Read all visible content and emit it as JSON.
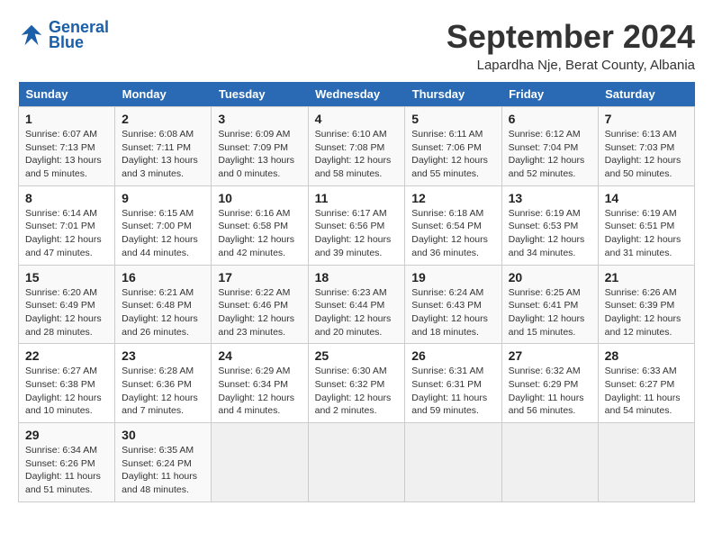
{
  "header": {
    "logo_line1": "General",
    "logo_line2": "Blue",
    "month_title": "September 2024",
    "location": "Lapardha Nje, Berat County, Albania"
  },
  "columns": [
    "Sunday",
    "Monday",
    "Tuesday",
    "Wednesday",
    "Thursday",
    "Friday",
    "Saturday"
  ],
  "weeks": [
    [
      {
        "day": "1",
        "info": "Sunrise: 6:07 AM\nSunset: 7:13 PM\nDaylight: 13 hours\nand 5 minutes."
      },
      {
        "day": "2",
        "info": "Sunrise: 6:08 AM\nSunset: 7:11 PM\nDaylight: 13 hours\nand 3 minutes."
      },
      {
        "day": "3",
        "info": "Sunrise: 6:09 AM\nSunset: 7:09 PM\nDaylight: 13 hours\nand 0 minutes."
      },
      {
        "day": "4",
        "info": "Sunrise: 6:10 AM\nSunset: 7:08 PM\nDaylight: 12 hours\nand 58 minutes."
      },
      {
        "day": "5",
        "info": "Sunrise: 6:11 AM\nSunset: 7:06 PM\nDaylight: 12 hours\nand 55 minutes."
      },
      {
        "day": "6",
        "info": "Sunrise: 6:12 AM\nSunset: 7:04 PM\nDaylight: 12 hours\nand 52 minutes."
      },
      {
        "day": "7",
        "info": "Sunrise: 6:13 AM\nSunset: 7:03 PM\nDaylight: 12 hours\nand 50 minutes."
      }
    ],
    [
      {
        "day": "8",
        "info": "Sunrise: 6:14 AM\nSunset: 7:01 PM\nDaylight: 12 hours\nand 47 minutes."
      },
      {
        "day": "9",
        "info": "Sunrise: 6:15 AM\nSunset: 7:00 PM\nDaylight: 12 hours\nand 44 minutes."
      },
      {
        "day": "10",
        "info": "Sunrise: 6:16 AM\nSunset: 6:58 PM\nDaylight: 12 hours\nand 42 minutes."
      },
      {
        "day": "11",
        "info": "Sunrise: 6:17 AM\nSunset: 6:56 PM\nDaylight: 12 hours\nand 39 minutes."
      },
      {
        "day": "12",
        "info": "Sunrise: 6:18 AM\nSunset: 6:54 PM\nDaylight: 12 hours\nand 36 minutes."
      },
      {
        "day": "13",
        "info": "Sunrise: 6:19 AM\nSunset: 6:53 PM\nDaylight: 12 hours\nand 34 minutes."
      },
      {
        "day": "14",
        "info": "Sunrise: 6:19 AM\nSunset: 6:51 PM\nDaylight: 12 hours\nand 31 minutes."
      }
    ],
    [
      {
        "day": "15",
        "info": "Sunrise: 6:20 AM\nSunset: 6:49 PM\nDaylight: 12 hours\nand 28 minutes."
      },
      {
        "day": "16",
        "info": "Sunrise: 6:21 AM\nSunset: 6:48 PM\nDaylight: 12 hours\nand 26 minutes."
      },
      {
        "day": "17",
        "info": "Sunrise: 6:22 AM\nSunset: 6:46 PM\nDaylight: 12 hours\nand 23 minutes."
      },
      {
        "day": "18",
        "info": "Sunrise: 6:23 AM\nSunset: 6:44 PM\nDaylight: 12 hours\nand 20 minutes."
      },
      {
        "day": "19",
        "info": "Sunrise: 6:24 AM\nSunset: 6:43 PM\nDaylight: 12 hours\nand 18 minutes."
      },
      {
        "day": "20",
        "info": "Sunrise: 6:25 AM\nSunset: 6:41 PM\nDaylight: 12 hours\nand 15 minutes."
      },
      {
        "day": "21",
        "info": "Sunrise: 6:26 AM\nSunset: 6:39 PM\nDaylight: 12 hours\nand 12 minutes."
      }
    ],
    [
      {
        "day": "22",
        "info": "Sunrise: 6:27 AM\nSunset: 6:38 PM\nDaylight: 12 hours\nand 10 minutes."
      },
      {
        "day": "23",
        "info": "Sunrise: 6:28 AM\nSunset: 6:36 PM\nDaylight: 12 hours\nand 7 minutes."
      },
      {
        "day": "24",
        "info": "Sunrise: 6:29 AM\nSunset: 6:34 PM\nDaylight: 12 hours\nand 4 minutes."
      },
      {
        "day": "25",
        "info": "Sunrise: 6:30 AM\nSunset: 6:32 PM\nDaylight: 12 hours\nand 2 minutes."
      },
      {
        "day": "26",
        "info": "Sunrise: 6:31 AM\nSunset: 6:31 PM\nDaylight: 11 hours\nand 59 minutes."
      },
      {
        "day": "27",
        "info": "Sunrise: 6:32 AM\nSunset: 6:29 PM\nDaylight: 11 hours\nand 56 minutes."
      },
      {
        "day": "28",
        "info": "Sunrise: 6:33 AM\nSunset: 6:27 PM\nDaylight: 11 hours\nand 54 minutes."
      }
    ],
    [
      {
        "day": "29",
        "info": "Sunrise: 6:34 AM\nSunset: 6:26 PM\nDaylight: 11 hours\nand 51 minutes."
      },
      {
        "day": "30",
        "info": "Sunrise: 6:35 AM\nSunset: 6:24 PM\nDaylight: 11 hours\nand 48 minutes."
      },
      {
        "day": "",
        "info": ""
      },
      {
        "day": "",
        "info": ""
      },
      {
        "day": "",
        "info": ""
      },
      {
        "day": "",
        "info": ""
      },
      {
        "day": "",
        "info": ""
      }
    ]
  ]
}
